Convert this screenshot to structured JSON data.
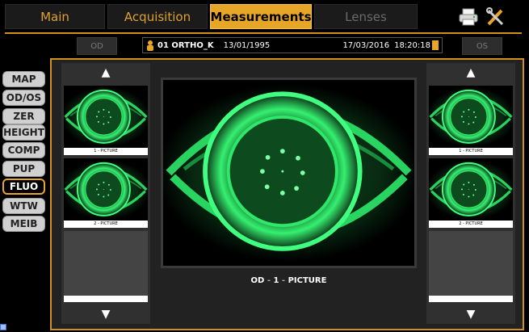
{
  "tabs": [
    {
      "label": "Main",
      "state": "normal"
    },
    {
      "label": "Acquisition",
      "state": "normal"
    },
    {
      "label": "Measurements",
      "state": "active"
    },
    {
      "label": "Lenses",
      "state": "disabled"
    }
  ],
  "tools": {
    "print_icon": "printer-icon",
    "settings_icon": "tools-icon"
  },
  "eyes": {
    "left": "OD",
    "right": "OS"
  },
  "patient": {
    "name": "01 ORTHO_K",
    "birthdate": "13/01/1995",
    "exam_date": "17/03/2016",
    "exam_time": "18:20:18"
  },
  "side_menu": [
    {
      "label": "MAP",
      "active": false
    },
    {
      "label": "OD/OS",
      "active": false
    },
    {
      "label": "ZER",
      "active": false
    },
    {
      "label": "HEIGHT",
      "active": false
    },
    {
      "label": "COMP",
      "active": false
    },
    {
      "label": "PUP",
      "active": false
    },
    {
      "label": "FLUO",
      "active": true
    },
    {
      "label": "WTW",
      "active": false
    },
    {
      "label": "MEIB",
      "active": false
    }
  ],
  "left_thumbs": {
    "up": "▲",
    "down": "▼",
    "items": [
      {
        "label": "1 - PICTURE"
      },
      {
        "label": "2 - PICTURE"
      }
    ]
  },
  "right_thumbs": {
    "up": "▲",
    "down": "▼",
    "items": [
      {
        "label": "1 - PICTURE"
      },
      {
        "label": "2 - PICTURE"
      }
    ]
  },
  "main_image": {
    "caption_eye": "OD",
    "caption_sep1": " - ",
    "caption_num": "1",
    "caption_sep2": " - ",
    "caption_text": "PICTURE"
  },
  "colors": {
    "accent": "#e8a628",
    "fluo_green": "#2ee86a",
    "frame": "#d4901e"
  }
}
